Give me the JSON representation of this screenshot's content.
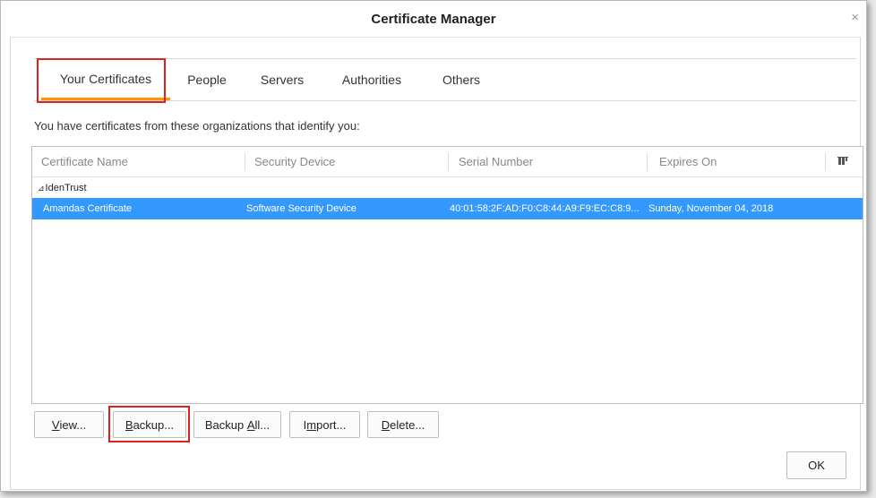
{
  "window": {
    "title": "Certificate Manager",
    "close_glyph": "×"
  },
  "tabs": [
    {
      "label": "Your Certificates",
      "selected": true
    },
    {
      "label": "People",
      "selected": false
    },
    {
      "label": "Servers",
      "selected": false
    },
    {
      "label": "Authorities",
      "selected": false
    },
    {
      "label": "Others",
      "selected": false
    }
  ],
  "intro_text": "You have certificates from these organizations that identify you:",
  "table": {
    "columns": [
      "Certificate Name",
      "Security Device",
      "Serial Number",
      "Expires On"
    ],
    "column_picker_icon": "column-picker-icon",
    "group": {
      "twisty": "⊿",
      "name": "IdenTrust"
    },
    "rows": [
      {
        "name": "Amandas Certificate",
        "device": "Software Security Device",
        "serial": "40:01:58:2F:AD:F0:C8:44:A9:F9:EC:C8:9...",
        "expires": "Sunday, November 04, 2018",
        "selected": true
      }
    ]
  },
  "buttons": {
    "view": {
      "access": "V",
      "rest": "iew..."
    },
    "backup": {
      "access": "B",
      "rest": "ackup..."
    },
    "backup_all": {
      "pre": "Backup ",
      "access": "A",
      "rest": "ll..."
    },
    "import": {
      "pre": "I",
      "access": "m",
      "rest": "port..."
    },
    "delete": {
      "access": "D",
      "rest": "elete..."
    },
    "ok": "OK"
  },
  "colors": {
    "selection": "#3399ff",
    "tab_accent": "#ff9400",
    "highlight_box": "#e2201f"
  }
}
